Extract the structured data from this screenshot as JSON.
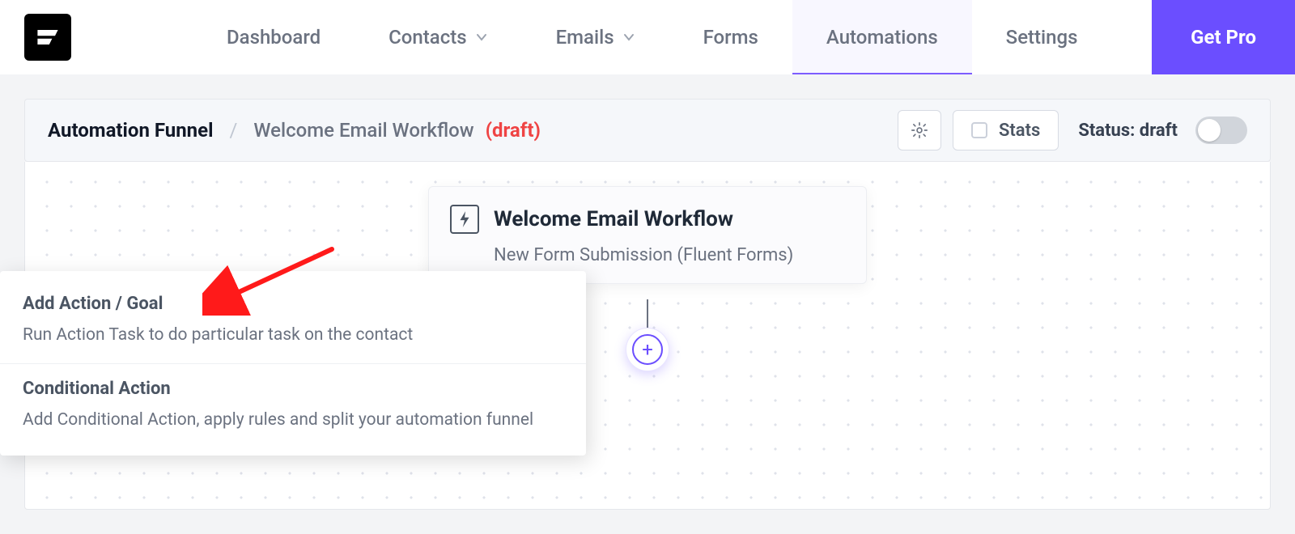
{
  "nav": {
    "items": [
      {
        "label": "Dashboard",
        "hasDropdown": false,
        "active": false
      },
      {
        "label": "Contacts",
        "hasDropdown": true,
        "active": false
      },
      {
        "label": "Emails",
        "hasDropdown": true,
        "active": false
      },
      {
        "label": "Forms",
        "hasDropdown": false,
        "active": false
      },
      {
        "label": "Automations",
        "hasDropdown": false,
        "active": true
      },
      {
        "label": "Settings",
        "hasDropdown": false,
        "active": false
      }
    ],
    "get_pro_label": "Get Pro"
  },
  "header": {
    "breadcrumb_root": "Automation Funnel",
    "breadcrumb_sep": "/",
    "workflow_name": "Welcome Email Workflow",
    "draft_tag": "(draft)",
    "stats_label": "Stats",
    "status_label": "Status: draft"
  },
  "node": {
    "title": "Welcome Email Workflow",
    "subtitle": "New Form Submission (Fluent Forms)"
  },
  "popover": {
    "items": [
      {
        "title": "Add Action / Goal",
        "desc": "Run Action Task to do particular task on the contact"
      },
      {
        "title": "Conditional Action",
        "desc": "Add Conditional Action, apply rules and split your automation funnel"
      }
    ]
  }
}
